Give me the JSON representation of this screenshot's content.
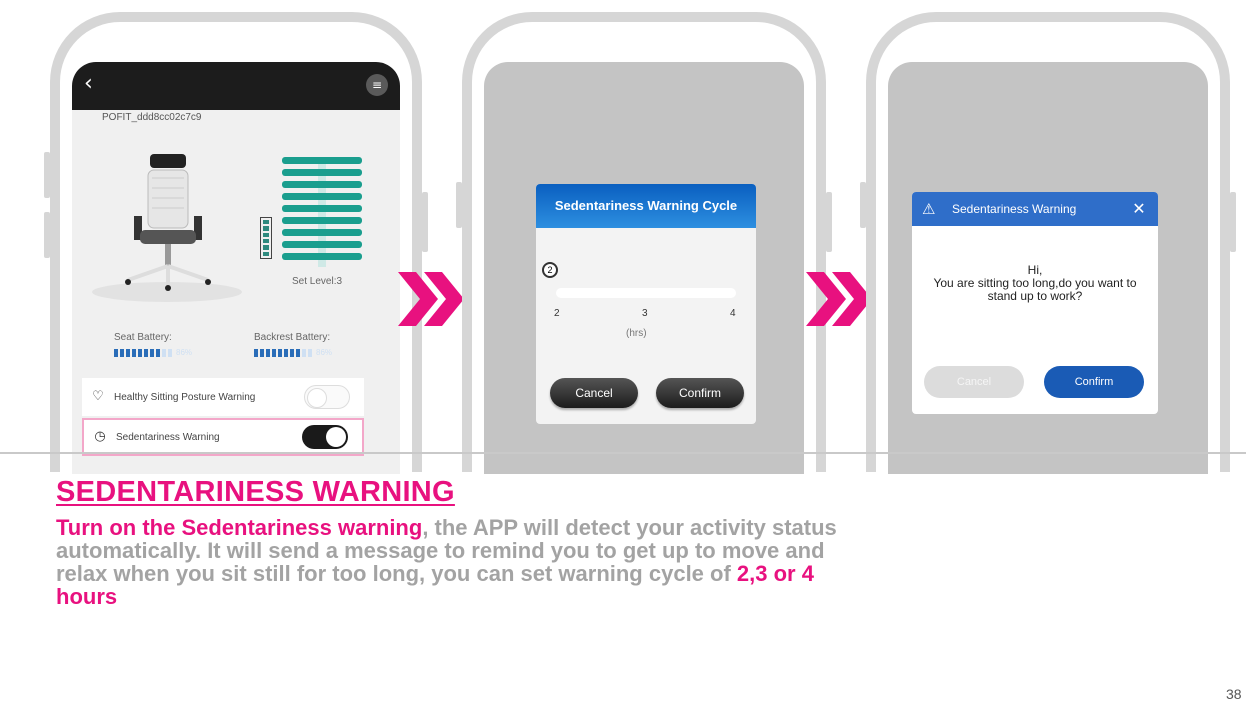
{
  "phone1": {
    "device_name": "POFIT_ddd8cc02c7c9",
    "set_level": "Set Level:3",
    "seat_battery_label": "Seat Battery:",
    "seat_battery_pct": "86%",
    "backrest_battery_label": "Backrest Battery:",
    "backrest_battery_pct": "86%",
    "healthy_posture_label": "Healthy Sitting Posture Warning",
    "healthy_posture_on": false,
    "sedentariness_label": "Sedentariness Warning",
    "sedentariness_on": true
  },
  "phone2": {
    "title": "Sedentariness Warning Cycle",
    "slider_value": "2",
    "ticks": [
      "2",
      "3",
      "4"
    ],
    "unit": "(hrs)",
    "cancel_label": "Cancel",
    "confirm_label": "Confirm"
  },
  "phone3": {
    "title": "Sedentariness Warning",
    "msg_line1": "Hi,",
    "msg_line2": "You are sitting too long,do you want to stand up to work?",
    "cancel_label": "Cancel",
    "confirm_label": "Confirm"
  },
  "text": {
    "heading": "SEDENTARINESS WARNING",
    "lead": "Turn on the Sedentariness warning",
    "body": ", the APP will detect your activity status automatically. It will send a message to remind you to get up to move and relax when you sit still for too long, you can set warning cycle of ",
    "highlight": "2,3 or 4 hours",
    "page_number": "38"
  },
  "colors": {
    "accent_pink": "#e8117f",
    "dialog_blue": "#2f6ec9",
    "chair_teal": "#1a9e8e"
  },
  "icons": [
    "back-arrow-icon",
    "menu-icon",
    "heart-icon",
    "clock-icon",
    "warning-icon",
    "close-icon",
    "double-chevron-icon"
  ]
}
